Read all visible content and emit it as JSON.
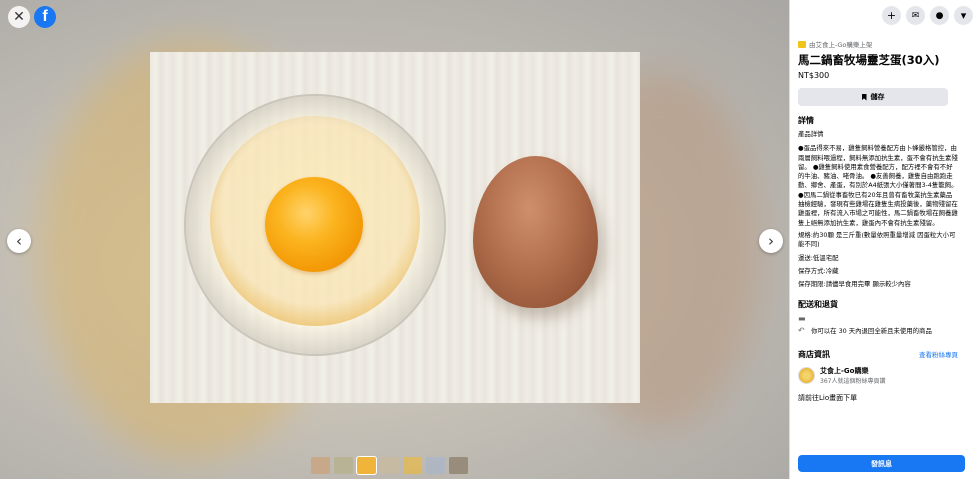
{
  "viewer": {
    "close_icon": "close-icon",
    "brand_icon": "facebook-icon",
    "brand_letter": "f",
    "prev_arrow": "‹",
    "next_arrow": "›",
    "thumbnail_count": 7,
    "thumbnail_colors": [
      "#c9a27a",
      "#b7b08c",
      "#f0b43a",
      "#c9b99e",
      "#e6b84a",
      "#a9b5c8",
      "#8c7d6a"
    ]
  },
  "header": {
    "buttons": [
      {
        "icon": "plus-icon",
        "glyph": "+"
      },
      {
        "icon": "messenger-icon",
        "glyph": "✉"
      },
      {
        "icon": "bell-icon",
        "glyph": "🔔"
      },
      {
        "icon": "chevron-down-icon",
        "glyph": "▾"
      }
    ]
  },
  "listing": {
    "breadcrumb": "由艾食上-Go購樂上架",
    "title": "馬二鍋畜牧場靈芝蛋(30入)",
    "price": "NT$300",
    "save_label": "儲存",
    "details_heading": "詳情",
    "details_label": "產品詳情",
    "description": "●蛋品得來不易，雞隻飼料營養配方由卜蜂嚴格管控，由兩層飼料喂過程，飼料無添加抗生素，蛋不會有抗生素殘留。 ●雞隻飼料使用素食營養配方，配方裡不會有不好的牛油、豬油、咾骨油。 ●友善飼養，雞隻自由跑跑走動、鄉舍、產蛋，有別於A4紙張大小僅著間3-4隻籠飼。 ●因馬二鍋從事畜牧已有20年且曾有畜牧業抗生素藥品抽檢經驗，發現有些雞場在雞隻生病投藥後，藥物殘留在雞蛋裡，所有流入市場之可能性，馬二鍋畜牧場在飼養雞隻上絕無添加抗生素，雞蛋內不會有抗生素殘留。",
    "spec": "規格:約30顆 是三斤重(數量依照重量增減 因蛋粒大小可能不同)",
    "shipping_method": "運送:低溫宅配",
    "storage": "保存方式:冷藏",
    "shelf_life": "保存期限:請儘早食用完畢 顯示較少內容",
    "delivery_heading": "配送和退貨",
    "return_note": "你可以在 30 天內退回全新且未使用的商品",
    "shop_heading": "商店資訊",
    "shop_link": "查看粉絲專頁",
    "shop_name": "艾食上-Go購樂",
    "shop_followers": "367人就這個粉絲專頁讚",
    "cutoff_text": "請前往Lio畫面下單",
    "message_button": "發訊息"
  }
}
